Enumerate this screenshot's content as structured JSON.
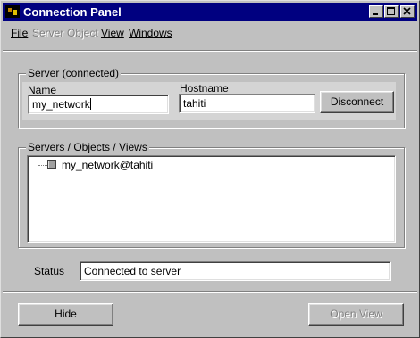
{
  "window": {
    "title": "Connection Panel"
  },
  "menu": {
    "file": "File",
    "server": "Server",
    "object": "Object",
    "view": "View",
    "windows": "Windows"
  },
  "server_group": {
    "label": "Server (connected)",
    "name_label": "Name",
    "name_value": "my_network",
    "hostname_label": "Hostname",
    "hostname_value": "tahiti",
    "disconnect_label": "Disconnect"
  },
  "tree_group": {
    "label": "Servers / Objects / Views",
    "items": [
      {
        "label": "my_network@tahiti",
        "icon": "server-icon"
      }
    ]
  },
  "status": {
    "label": "Status",
    "value": "Connected to server"
  },
  "footer": {
    "hide_label": "Hide",
    "open_view_label": "Open View"
  }
}
